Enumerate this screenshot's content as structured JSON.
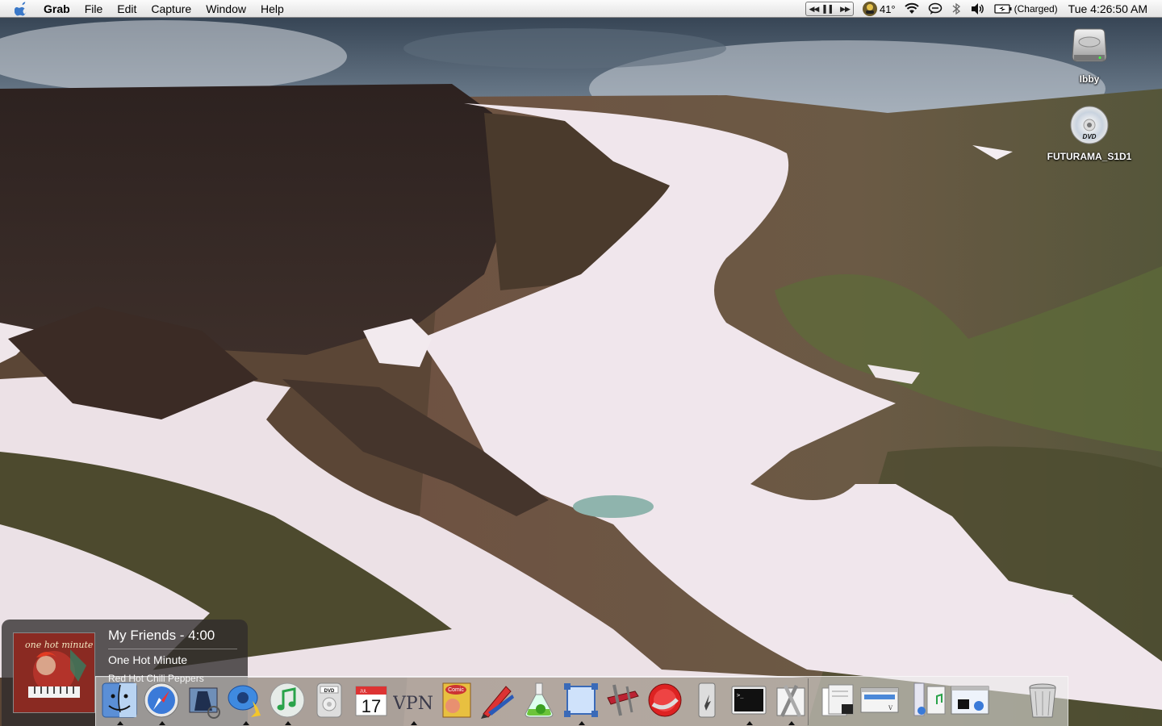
{
  "menubar": {
    "app_name": "Grab",
    "items": [
      "File",
      "Edit",
      "Capture",
      "Window",
      "Help"
    ],
    "weather": "41°",
    "battery": "(Charged)",
    "clock": "Tue 4:26:50 AM",
    "status_icons": [
      "itunes-controls-icon",
      "weather-icon",
      "wifi-icon",
      "ichat-status-icon",
      "bluetooth-icon",
      "volume-icon",
      "battery-icon"
    ]
  },
  "desktop": {
    "icons": [
      {
        "label": "Ibby",
        "icon": "hard-drive-icon"
      },
      {
        "label": "FUTURAMA_S1D1",
        "icon": "dvd-disc-icon"
      }
    ]
  },
  "now_playing": {
    "song": "My Friends - 4:00",
    "album": "One Hot Minute",
    "artist": "Red Hot Chili Peppers",
    "album_art_text": "one hot minute"
  },
  "dock": {
    "apps": [
      {
        "name": "finder",
        "icon": "finder-icon"
      },
      {
        "name": "safari",
        "icon": "safari-icon"
      },
      {
        "name": "mail",
        "icon": "mail-icon"
      },
      {
        "name": "ichat",
        "icon": "ichat-icon"
      },
      {
        "name": "itunes",
        "icon": "itunes-icon"
      },
      {
        "name": "dvd-player",
        "icon": "dvd-player-icon"
      },
      {
        "name": "ical",
        "icon": "ical-icon",
        "date": "17",
        "month": "JUL"
      },
      {
        "name": "vpn",
        "icon": "vpn-icon",
        "text": "VPN"
      },
      {
        "name": "comic-life",
        "icon": "comic-life-icon",
        "text": "Comic"
      },
      {
        "name": "textedit-pen",
        "icon": "pen-icon"
      },
      {
        "name": "chemistry",
        "icon": "flask-icon"
      },
      {
        "name": "grab",
        "icon": "grab-icon"
      },
      {
        "name": "xcode-tools",
        "icon": "xcode-icon"
      },
      {
        "name": "aim",
        "icon": "aim-icon"
      },
      {
        "name": "utilities",
        "icon": "utility-icon"
      },
      {
        "name": "terminal",
        "icon": "terminal-icon"
      },
      {
        "name": "script-editor",
        "icon": "script-icon"
      }
    ],
    "right": [
      {
        "name": "documents-stack",
        "icon": "documents-icon"
      },
      {
        "name": "window-minimized-1",
        "icon": "window-icon"
      },
      {
        "name": "applications-stack",
        "icon": "applications-icon"
      },
      {
        "name": "window-minimized-2",
        "icon": "window-icon"
      },
      {
        "name": "trash",
        "icon": "trash-icon"
      }
    ]
  }
}
